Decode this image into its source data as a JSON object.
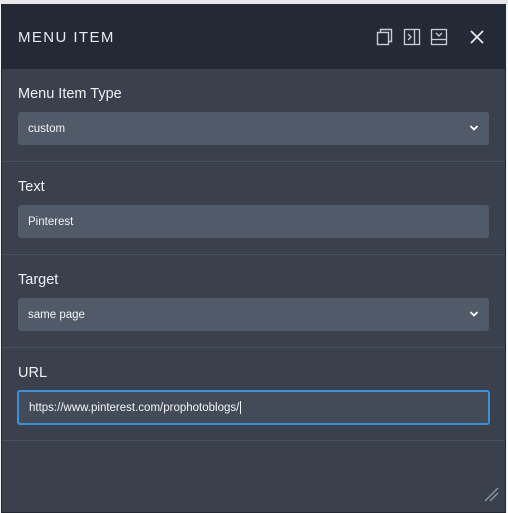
{
  "panel": {
    "title": "MENU ITEM",
    "icons": [
      "duplicate-icon",
      "dock-right-icon",
      "dock-bottom-icon",
      "close-icon"
    ]
  },
  "fields": {
    "menu_item_type": {
      "label": "Menu Item Type",
      "value": "custom"
    },
    "text": {
      "label": "Text",
      "value": "Pinterest"
    },
    "target": {
      "label": "Target",
      "value": "same page"
    },
    "url": {
      "label": "URL",
      "value": "https://www.pinterest.com/prophotoblogs/"
    }
  },
  "colors": {
    "panel_bg": "#3a414d",
    "header_bg": "#232a35",
    "field_bg": "#515a68",
    "focus_border": "#3f8fd6"
  }
}
